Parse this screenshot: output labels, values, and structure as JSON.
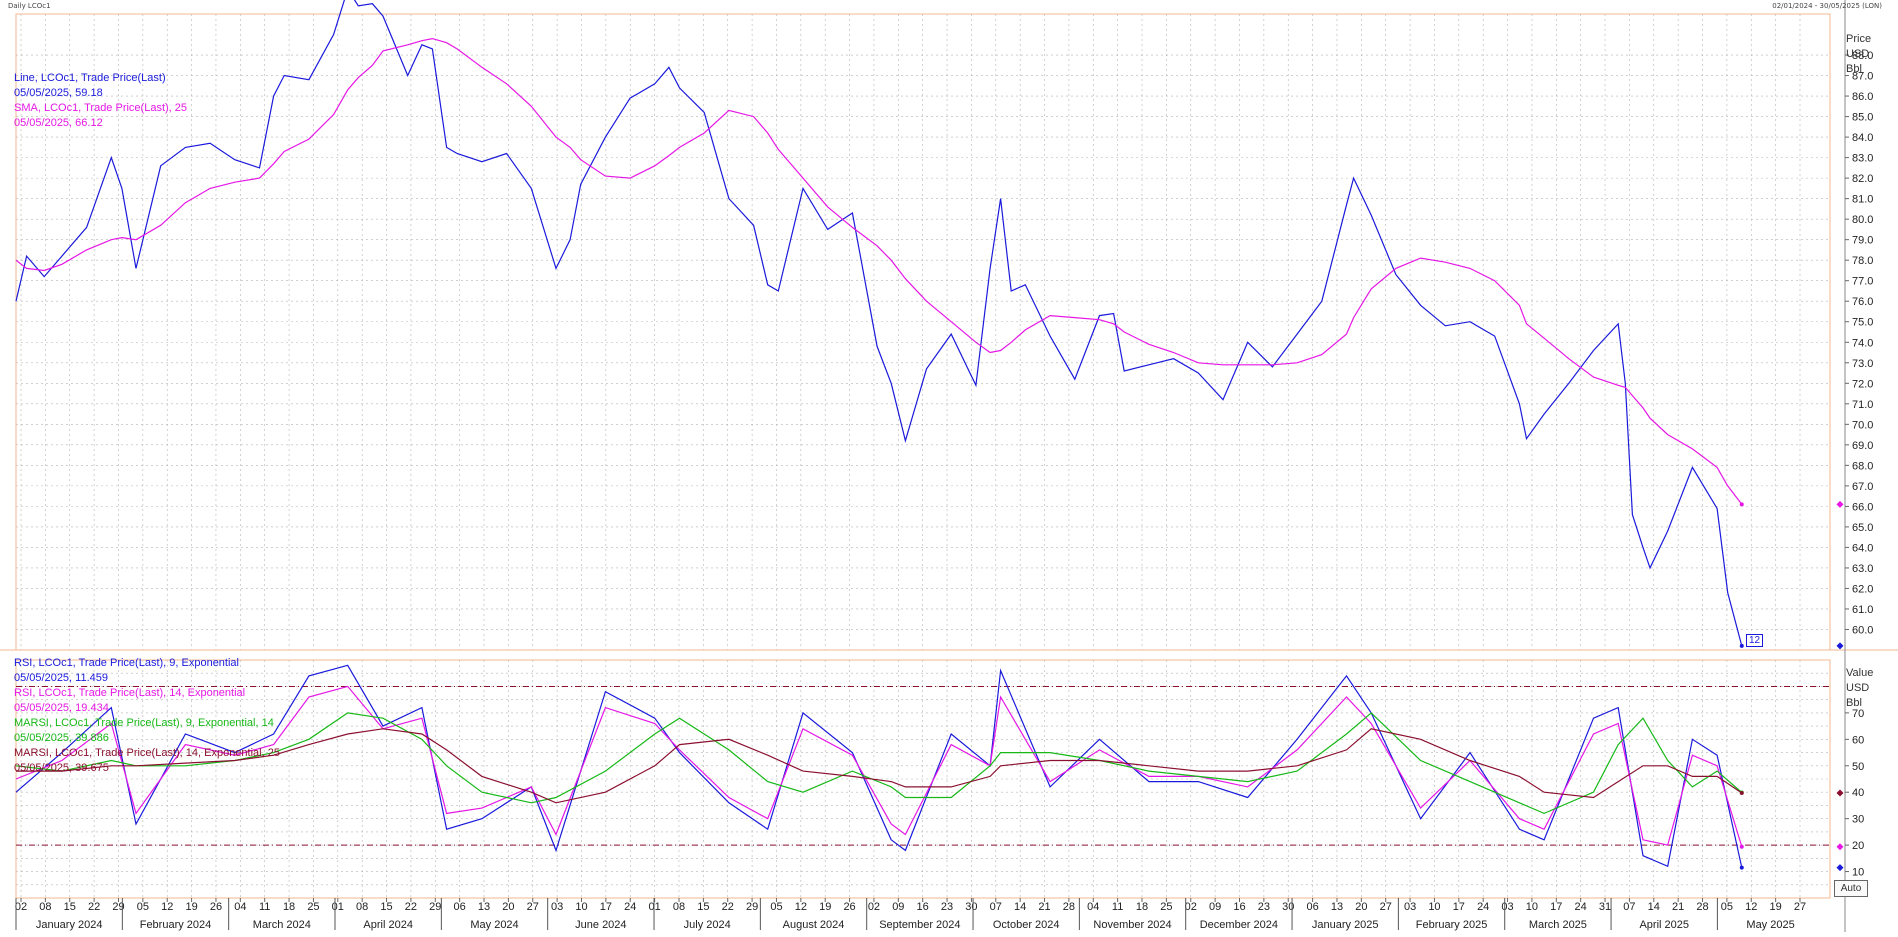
{
  "header": {
    "left": "Daily LCOc1",
    "right": "02/01/2024 - 30/05/2025 (LON)"
  },
  "price_axis_title": [
    "Price",
    "USD",
    "Bbl"
  ],
  "value_axis_title": [
    "Value",
    "USD",
    "Bbl"
  ],
  "auto_label": "Auto",
  "price_tag": "12",
  "legend_price": [
    {
      "text": "Line, LCOc1, Trade Price(Last)",
      "color": "#1a1adc"
    },
    {
      "text": "05/05/2025, 59.18",
      "color": "#1a1adc"
    },
    {
      "text": "SMA, LCOc1, Trade Price(Last),  25",
      "color": "#e617e6"
    },
    {
      "text": "05/05/2025, 66.12",
      "color": "#e617e6"
    }
  ],
  "legend_osc": [
    {
      "text": "RSI, LCOc1, Trade Price(Last),  9, Exponential",
      "color": "#1a1adc"
    },
    {
      "text": "05/05/2025, 11.459",
      "color": "#1a1adc"
    },
    {
      "text": "RSI, LCOc1, Trade Price(Last),  14, Exponential",
      "color": "#e617e6"
    },
    {
      "text": "05/05/2025, 19.434",
      "color": "#e617e6"
    },
    {
      "text": "MARSI, LCOc1, Trade Price(Last),  9, Exponential, 14",
      "color": "#17b817"
    },
    {
      "text": "05/05/2025, 39.886",
      "color": "#17b817"
    },
    {
      "text": "MARSI, LCOc1, Trade Price(Last),  14, Exponential, 25",
      "color": "#8b1030"
    },
    {
      "text": "05/05/2025, 39.675",
      "color": "#8b1030"
    }
  ],
  "colors": {
    "line": "#1a1adc",
    "sma": "#e617e6",
    "rsi9": "#1a1adc",
    "rsi14": "#e617e6",
    "marsi9": "#17b817",
    "marsi14": "#8b1030",
    "grid": "#b4b4b4",
    "frame": "#f0b890",
    "ref": "#8b1030"
  },
  "x_axis": {
    "day_ticks": [
      "02",
      "08",
      "15",
      "22",
      "29",
      "05",
      "12",
      "19",
      "26",
      "04",
      "11",
      "18",
      "25",
      "01",
      "08",
      "15",
      "22",
      "29",
      "06",
      "13",
      "20",
      "27",
      "03",
      "10",
      "17",
      "24",
      "01",
      "08",
      "15",
      "22",
      "29",
      "05",
      "12",
      "19",
      "26",
      "02",
      "09",
      "16",
      "23",
      "30",
      "07",
      "14",
      "21",
      "28",
      "04",
      "11",
      "18",
      "25",
      "02",
      "09",
      "16",
      "23",
      "30",
      "06",
      "13",
      "20",
      "27",
      "03",
      "10",
      "17",
      "24",
      "03",
      "10",
      "17",
      "24",
      "31",
      "07",
      "14",
      "21",
      "28",
      "05",
      "12",
      "19",
      "27"
    ],
    "months": [
      "January 2024",
      "February 2024",
      "March 2024",
      "April 2024",
      "May 2024",
      "June 2024",
      "July 2024",
      "August 2024",
      "September 2024",
      "October 2024",
      "November 2024",
      "December 2024",
      "January 2025",
      "February 2025",
      "March 2025",
      "April 2025",
      "May 2025"
    ]
  },
  "chart_data": [
    {
      "type": "line",
      "title": "",
      "x_range": [
        "02/01/2024",
        "30/05/2025"
      ],
      "ylabel": "Price USD Bbl",
      "ylim": [
        59.0,
        90.0
      ],
      "yticks": [
        60,
        61,
        62,
        63,
        64,
        65,
        66,
        67,
        68,
        69,
        70,
        71,
        72,
        73,
        74,
        75,
        76,
        77,
        78,
        79,
        80,
        81,
        82,
        83,
        84,
        85,
        86,
        87,
        88
      ],
      "grid": true,
      "x": [
        "2024-01-02",
        "2024-01-05",
        "2024-01-10",
        "2024-01-15",
        "2024-01-22",
        "2024-01-29",
        "2024-02-01",
        "2024-02-05",
        "2024-02-12",
        "2024-02-19",
        "2024-02-26",
        "2024-03-04",
        "2024-03-11",
        "2024-03-15",
        "2024-03-18",
        "2024-03-25",
        "2024-04-01",
        "2024-04-05",
        "2024-04-08",
        "2024-04-12",
        "2024-04-15",
        "2024-04-22",
        "2024-04-26",
        "2024-04-29",
        "2024-05-03",
        "2024-05-06",
        "2024-05-13",
        "2024-05-20",
        "2024-05-27",
        "2024-06-03",
        "2024-06-07",
        "2024-06-10",
        "2024-06-17",
        "2024-06-24",
        "2024-07-01",
        "2024-07-05",
        "2024-07-08",
        "2024-07-15",
        "2024-07-22",
        "2024-07-29",
        "2024-08-02",
        "2024-08-05",
        "2024-08-12",
        "2024-08-19",
        "2024-08-26",
        "2024-09-02",
        "2024-09-06",
        "2024-09-10",
        "2024-09-16",
        "2024-09-23",
        "2024-09-30",
        "2024-10-04",
        "2024-10-07",
        "2024-10-10",
        "2024-10-14",
        "2024-10-21",
        "2024-10-28",
        "2024-11-04",
        "2024-11-08",
        "2024-11-11",
        "2024-11-18",
        "2024-11-25",
        "2024-12-02",
        "2024-12-09",
        "2024-12-16",
        "2024-12-23",
        "2024-12-30",
        "2025-01-06",
        "2025-01-13",
        "2025-01-15",
        "2025-01-20",
        "2025-01-27",
        "2025-02-03",
        "2025-02-10",
        "2025-02-17",
        "2025-02-24",
        "2025-03-03",
        "2025-03-05",
        "2025-03-10",
        "2025-03-17",
        "2025-03-24",
        "2025-03-31",
        "2025-04-02",
        "2025-04-04",
        "2025-04-07",
        "2025-04-09",
        "2025-04-14",
        "2025-04-21",
        "2025-04-28",
        "2025-05-01",
        "2025-05-05"
      ],
      "series": [
        {
          "name": "Line, LCOc1, Trade Price(Last)",
          "values": [
            76.0,
            78.2,
            77.2,
            78.2,
            79.6,
            83.0,
            81.5,
            77.6,
            82.6,
            83.5,
            83.7,
            82.9,
            82.5,
            86.0,
            87.0,
            86.8,
            89.0,
            91.2,
            90.4,
            90.5,
            89.9,
            87.0,
            88.5,
            88.3,
            83.5,
            83.2,
            82.8,
            83.2,
            81.5,
            77.6,
            79.0,
            81.7,
            84.0,
            85.9,
            86.6,
            87.4,
            86.4,
            85.2,
            81.0,
            79.7,
            76.8,
            76.5,
            81.5,
            79.5,
            80.3,
            73.8,
            72.0,
            69.2,
            72.7,
            74.4,
            71.9,
            77.6,
            81.0,
            76.5,
            76.8,
            74.3,
            72.2,
            75.3,
            75.4,
            72.6,
            72.9,
            73.2,
            72.5,
            71.2,
            74.0,
            72.8,
            74.4,
            76.0,
            80.7,
            82.0,
            80.2,
            77.3,
            75.8,
            74.8,
            75.0,
            74.3,
            71.0,
            69.3,
            70.5,
            72.0,
            73.6,
            74.9,
            72.0,
            65.6,
            64.0,
            63.0,
            64.8,
            67.9,
            65.9,
            61.8,
            59.2
          ]
        },
        {
          "name": "SMA, LCOc1, Trade Price(Last),  25",
          "values": [
            78.0,
            77.6,
            77.5,
            77.8,
            78.5,
            79.0,
            79.1,
            79.0,
            79.7,
            80.8,
            81.5,
            81.8,
            82.0,
            82.7,
            83.3,
            83.9,
            85.1,
            86.3,
            86.9,
            87.5,
            88.2,
            88.5,
            88.7,
            88.8,
            88.6,
            88.3,
            87.4,
            86.6,
            85.5,
            84.0,
            83.5,
            82.9,
            82.1,
            82.0,
            82.6,
            83.1,
            83.5,
            84.2,
            85.3,
            85.0,
            84.2,
            83.4,
            82.0,
            80.6,
            79.6,
            78.7,
            78.0,
            77.1,
            76.0,
            75.0,
            74.0,
            73.5,
            73.6,
            74.0,
            74.6,
            75.3,
            75.2,
            75.1,
            74.9,
            74.5,
            73.9,
            73.5,
            73.0,
            72.9,
            72.9,
            72.9,
            73.0,
            73.4,
            74.4,
            75.2,
            76.6,
            77.6,
            78.1,
            77.9,
            77.6,
            77.0,
            75.8,
            74.9,
            74.2,
            73.2,
            72.3,
            71.9,
            71.8,
            71.4,
            70.8,
            70.3,
            69.5,
            68.8,
            67.9,
            67.0,
            66.1
          ]
        }
      ]
    },
    {
      "type": "line",
      "title": "",
      "ylabel": "Value USD Bbl",
      "ylim": [
        0,
        90
      ],
      "yticks": [
        10,
        20,
        30,
        40,
        50,
        60,
        70
      ],
      "reference_lines": [
        80,
        20
      ],
      "grid": true,
      "x": [
        "2024-01-02",
        "2024-01-15",
        "2024-01-29",
        "2024-02-05",
        "2024-02-19",
        "2024-03-04",
        "2024-03-15",
        "2024-03-25",
        "2024-04-05",
        "2024-04-15",
        "2024-04-26",
        "2024-05-03",
        "2024-05-13",
        "2024-05-27",
        "2024-06-03",
        "2024-06-17",
        "2024-07-01",
        "2024-07-08",
        "2024-07-22",
        "2024-08-02",
        "2024-08-12",
        "2024-08-26",
        "2024-09-06",
        "2024-09-10",
        "2024-09-23",
        "2024-10-04",
        "2024-10-07",
        "2024-10-21",
        "2024-11-04",
        "2024-11-18",
        "2024-12-02",
        "2024-12-16",
        "2024-12-30",
        "2025-01-13",
        "2025-01-20",
        "2025-02-03",
        "2025-02-17",
        "2025-03-03",
        "2025-03-10",
        "2025-03-24",
        "2025-03-31",
        "2025-04-07",
        "2025-04-14",
        "2025-04-21",
        "2025-04-28",
        "2025-05-05"
      ],
      "series": [
        {
          "name": "RSI, LCOc1, Trade Price(Last),  9, Exponential",
          "values": [
            40,
            55,
            72,
            28,
            62,
            55,
            62,
            84,
            88,
            65,
            72,
            26,
            30,
            42,
            18,
            78,
            68,
            55,
            36,
            26,
            70,
            55,
            22,
            18,
            62,
            50,
            86,
            42,
            60,
            44,
            44,
            38,
            60,
            84,
            70,
            30,
            55,
            26,
            22,
            68,
            72,
            16,
            12,
            60,
            54,
            11.5
          ]
        },
        {
          "name": "RSI, LCOc1, Trade Price(Last),  14, Exponential",
          "values": [
            45,
            52,
            66,
            32,
            58,
            54,
            58,
            76,
            80,
            64,
            68,
            32,
            34,
            42,
            24,
            72,
            66,
            56,
            38,
            30,
            64,
            54,
            28,
            24,
            58,
            50,
            76,
            44,
            56,
            46,
            46,
            42,
            56,
            76,
            66,
            34,
            52,
            30,
            26,
            62,
            66,
            22,
            20,
            54,
            50,
            19.4
          ]
        },
        {
          "name": "MARSI, LCOc1, Trade Price(Last),  9, Exponential, 14",
          "values": [
            50,
            48,
            52,
            50,
            50,
            52,
            55,
            60,
            70,
            68,
            60,
            50,
            40,
            36,
            38,
            48,
            62,
            68,
            56,
            44,
            40,
            48,
            42,
            38,
            38,
            50,
            55,
            55,
            52,
            48,
            46,
            44,
            48,
            62,
            70,
            52,
            44,
            36,
            32,
            40,
            58,
            68,
            52,
            42,
            48,
            39.9
          ]
        },
        {
          "name": "MARSI, LCOc1, Trade Price(Last),  14, Exponential, 25",
          "values": [
            48,
            48,
            50,
            50,
            51,
            52,
            54,
            58,
            62,
            64,
            62,
            56,
            46,
            40,
            36,
            40,
            50,
            58,
            60,
            54,
            48,
            46,
            44,
            42,
            42,
            46,
            50,
            52,
            52,
            50,
            48,
            48,
            50,
            56,
            64,
            60,
            52,
            46,
            40,
            38,
            44,
            50,
            50,
            46,
            46,
            39.7
          ]
        }
      ]
    }
  ]
}
